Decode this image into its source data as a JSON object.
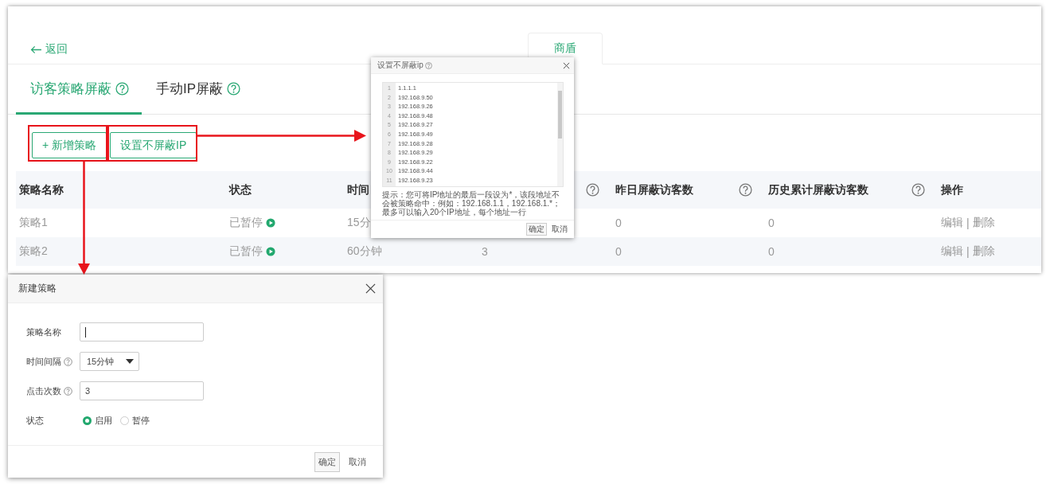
{
  "header": {
    "back_link": "返回",
    "section_tab": "商盾"
  },
  "tabs": [
    {
      "label": "访客策略屏蔽",
      "help": true,
      "selected": true
    },
    {
      "label": "手动IP屏蔽",
      "help": true,
      "selected": false
    }
  ],
  "actions": [
    "+ 新增策略",
    "设置不屏蔽IP"
  ],
  "table": {
    "columns": [
      {
        "label": "策略名称",
        "help": false
      },
      {
        "label": "状态",
        "help": false
      },
      {
        "label": "时间",
        "help": false
      },
      {
        "help": true
      },
      {
        "label": "昨日屏蔽访客数",
        "help": true
      },
      {
        "label": "历史累计屏蔽访客数",
        "help": true
      },
      {
        "label": "操作",
        "help": false
      }
    ],
    "rows": [
      {
        "name": "策略1",
        "status": "已暂停",
        "paused": true,
        "interval": "15分",
        "yesterday": "0",
        "total": "0",
        "edit": "编辑",
        "separator": "|",
        "delete": "删除"
      },
      {
        "name": "策略2",
        "status": "已暂停",
        "paused": true,
        "interval": "60分钟",
        "clicks": "3",
        "yesterday": "0",
        "total": "0",
        "edit": "编辑",
        "separator": "|",
        "delete": "删除"
      }
    ]
  },
  "ip_dialog": {
    "title": "设置不屏蔽ip",
    "help": true,
    "lines": [
      {
        "no": "1",
        "text": "1.1.1.1"
      },
      {
        "no": "2",
        "text": "192.168.9.50"
      },
      {
        "no": "3",
        "text": "192.168.9.26"
      },
      {
        "no": "4",
        "text": "192.168.9.48"
      },
      {
        "no": "5",
        "text": "192.168.9.27"
      },
      {
        "no": "6",
        "text": "192.168.9.49"
      },
      {
        "no": "7",
        "text": "192.168.9.28"
      },
      {
        "no": "8",
        "text": "192.168.9.29"
      },
      {
        "no": "9",
        "text": "192.168.9.22"
      },
      {
        "no": "10",
        "text": "192.168.9.44"
      },
      {
        "no": "11",
        "text": "192.168.9.23"
      }
    ],
    "hint": "提示：您可将IP地址的最后一段设为*，该段地址不会被策略命中：例如：192.168.1.1，192.168.1.*；最多可以输入20个IP地址，每个地址一行",
    "buttons": [
      {
        "label": "确定",
        "primary": true
      },
      {
        "label": "取消",
        "primary": false
      }
    ]
  },
  "new_dialog": {
    "title": "新建策略",
    "fields": [
      {
        "kind": "text",
        "label": "策略名称",
        "help": false,
        "focused": true
      },
      {
        "kind": "select",
        "label": "时间间隔",
        "help": true,
        "value": "15分钟"
      },
      {
        "kind": "text",
        "label": "点击次数",
        "help": true,
        "value": "3",
        "focused": false
      },
      {
        "kind": "radio",
        "label": "状态",
        "help": false,
        "options": [
          {
            "label": "启用",
            "selected": true
          },
          {
            "label": "暂停",
            "selected": false
          }
        ]
      }
    ],
    "buttons": [
      {
        "label": "确定",
        "primary": true
      },
      {
        "label": "取消",
        "primary": false
      }
    ]
  }
}
